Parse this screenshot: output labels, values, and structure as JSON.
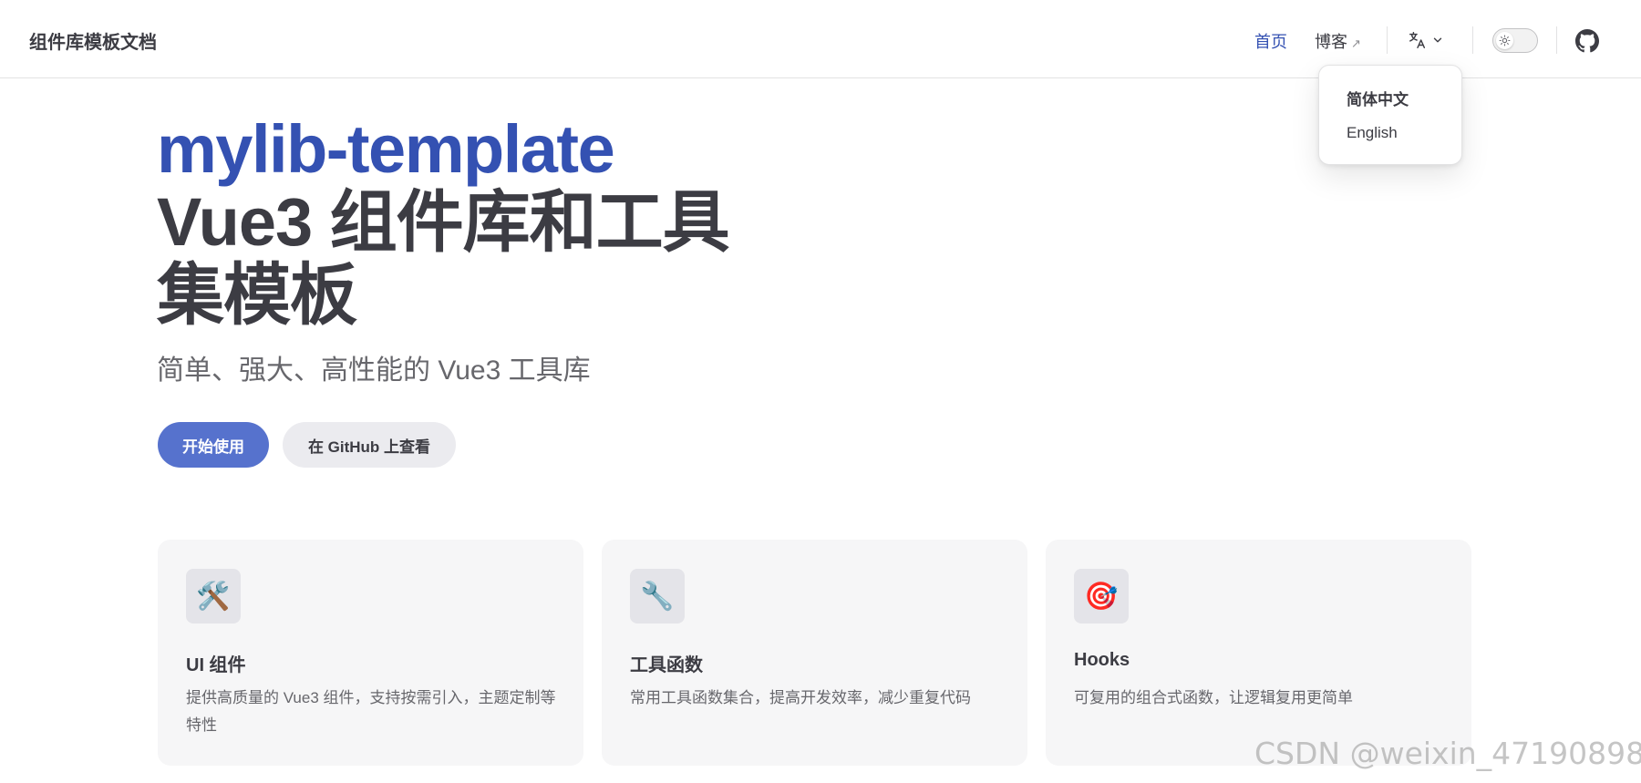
{
  "navbar": {
    "site_title": "组件库模板文档",
    "links": [
      {
        "label": "首页"
      },
      {
        "label": "博客",
        "external_mark": "↗"
      }
    ]
  },
  "language_menu": {
    "items": [
      "简体中文",
      "English"
    ],
    "current": "简体中文"
  },
  "hero": {
    "name": "mylib-template",
    "text": "Vue3 组件库和工具集模板",
    "tagline": "简单、强大、高性能的 Vue3 工具库",
    "actions": [
      {
        "label": "开始使用",
        "theme": "brand"
      },
      {
        "label": "在 GitHub 上查看",
        "theme": "alt"
      }
    ]
  },
  "features": [
    {
      "icon": "🛠️",
      "title": "UI 组件",
      "details": "提供高质量的 Vue3 组件，支持按需引入，主题定制等特性"
    },
    {
      "icon": "🔧",
      "title": "工具函数",
      "details": "常用工具函数集合，提高开发效率，减少重复代码"
    },
    {
      "icon": "🎯",
      "title": "Hooks",
      "details": "可复用的组合式函数，让逻辑复用更简单"
    }
  ],
  "watermark": "CSDN @weixin_47190898",
  "colors": {
    "brand": "#3451b2",
    "brand_button": "#5672cd",
    "text": "#3c3c43",
    "muted": "#67676c",
    "card_bg": "#f6f6f7"
  }
}
